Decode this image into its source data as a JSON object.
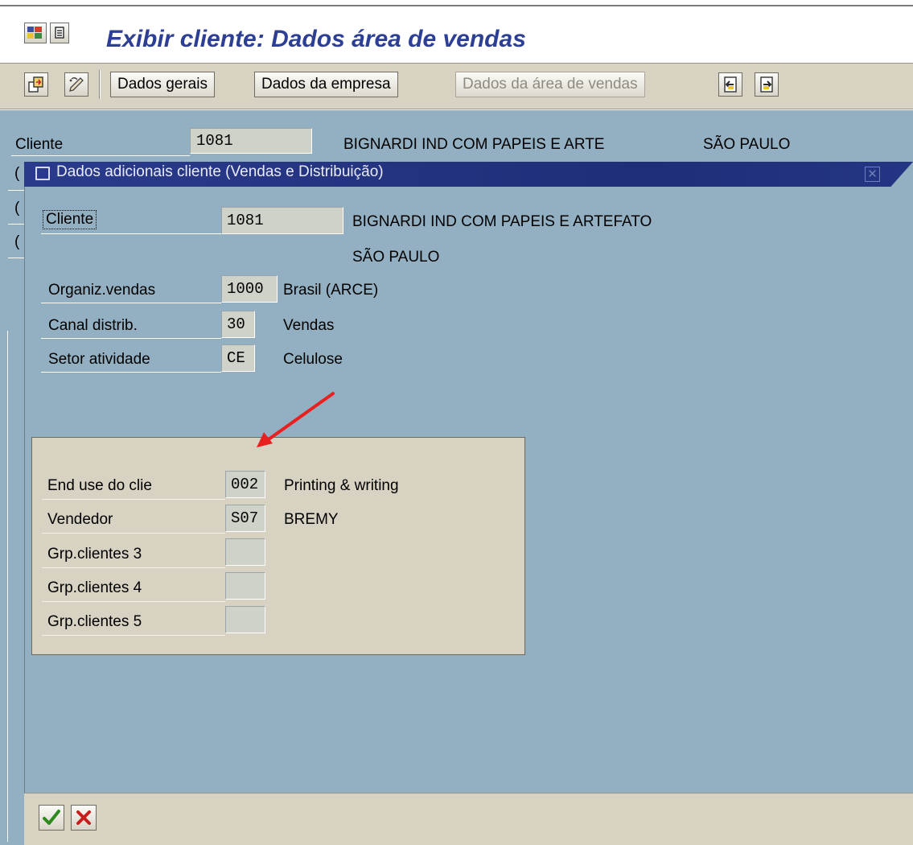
{
  "window": {
    "title": "Exibir cliente: Dados área de vendas"
  },
  "toolbar": {
    "buttons": [
      {
        "label": "Dados gerais",
        "enabled": true
      },
      {
        "label": "Dados da empresa",
        "enabled": true
      },
      {
        "label": "Dados da área de vendas",
        "enabled": false
      }
    ],
    "icons": [
      "other-customer-icon",
      "display-change-icon",
      "previous-screen-icon",
      "next-screen-icon"
    ]
  },
  "background_screen": {
    "cliente_label": "Cliente",
    "cliente_value": "1081",
    "cliente_name": "BIGNARDI IND COM PAPEIS  E ARTE",
    "cliente_city": "SÃO PAULO"
  },
  "popup": {
    "title": "Dados adicionais cliente (Vendas e Distribuição)",
    "header": {
      "cliente": {
        "label": "Cliente",
        "value": "1081",
        "name": "BIGNARDI IND COM PAPEIS  E ARTEFATO",
        "city": "SÃO PAULO"
      },
      "fields": [
        {
          "label": "Organiz.vendas",
          "value": "1000",
          "desc": "Brasil (ARCE)"
        },
        {
          "label": "Canal distrib.",
          "value": "30",
          "desc": "Vendas"
        },
        {
          "label": "Setor atividade",
          "value": "CE",
          "desc": "Celulose"
        }
      ]
    },
    "group": {
      "fields": [
        {
          "label": "End use do clie",
          "value": "002",
          "desc": "Printing & writing"
        },
        {
          "label": "Vendedor",
          "value": "S07",
          "desc": "BREMY"
        },
        {
          "label": "Grp.clientes 3",
          "value": "",
          "desc": ""
        },
        {
          "label": "Grp.clientes 4",
          "value": "",
          "desc": ""
        },
        {
          "label": "Grp.clientes 5",
          "value": "",
          "desc": ""
        }
      ]
    },
    "footer": {
      "icons": [
        "confirm-check-icon",
        "cancel-x-icon"
      ]
    }
  },
  "colors": {
    "title_text": "#2d3f95",
    "screen_background": "#93b0c2",
    "toolbar_background": "#d7d2c2",
    "popup_titlebar": "#2b3b8c",
    "annotation_arrow": "#e8201f"
  }
}
